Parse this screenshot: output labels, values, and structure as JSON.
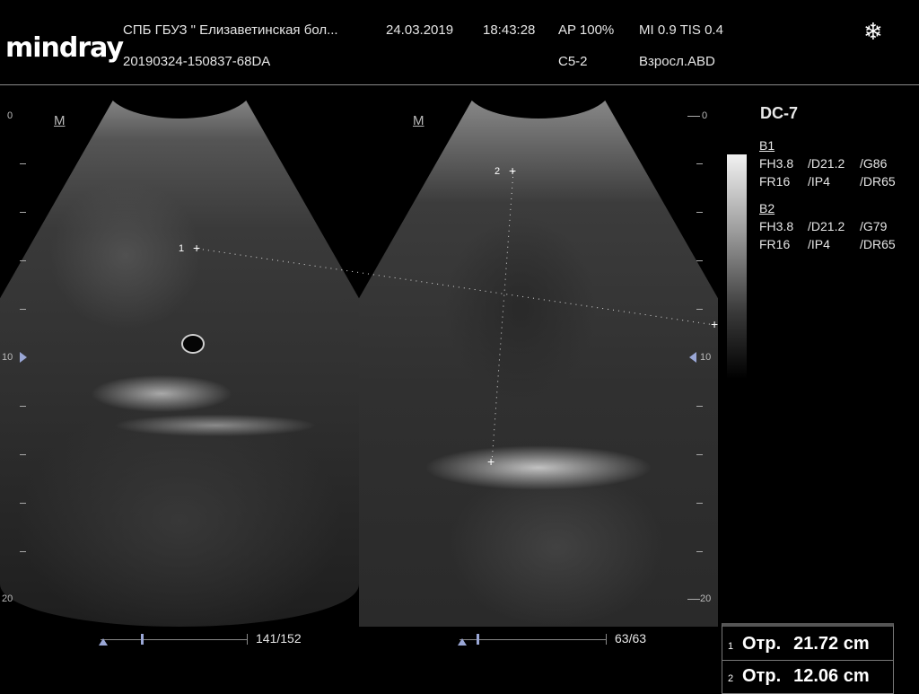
{
  "header": {
    "brand": "mindray",
    "institution": "СПБ ГБУЗ \" Елизаветинская бол...",
    "date": "24.03.2019",
    "time": "18:43:28",
    "ap": "AP 100%",
    "mi_tis": "MI 0.9 TIS 0.4",
    "exam_id": "20190324-150837-68DA",
    "probe": "C5-2",
    "preset": "Взросл.ABD",
    "freeze_icon": "snowflake-icon"
  },
  "images": {
    "left": {
      "orientation_mark": "M",
      "depth_top": "0",
      "depth_mid": "10",
      "depth_bottom": "20",
      "cine_count": "141/152",
      "caliper_1": "1"
    },
    "right": {
      "orientation_mark": "M",
      "depth_top": "0",
      "depth_mid": "10",
      "depth_bottom": "20",
      "cine_count": "63/63",
      "caliper_2": "2"
    }
  },
  "panel": {
    "title": "DC-7",
    "b1": {
      "label": "B1",
      "row1": [
        "FH3.8",
        "/D21.2",
        "/G86"
      ],
      "row2": [
        "FR16",
        "/IP4",
        "/DR65"
      ]
    },
    "b2": {
      "label": "B2",
      "row1": [
        "FH3.8",
        "/D21.2",
        "/G79"
      ],
      "row2": [
        "FR16",
        "/IP4",
        "/DR65"
      ]
    }
  },
  "measurements": [
    {
      "index": "1",
      "label": "Отр.",
      "value": "21.72 cm"
    },
    {
      "index": "2",
      "label": "Отр.",
      "value": "12.06 cm"
    }
  ]
}
